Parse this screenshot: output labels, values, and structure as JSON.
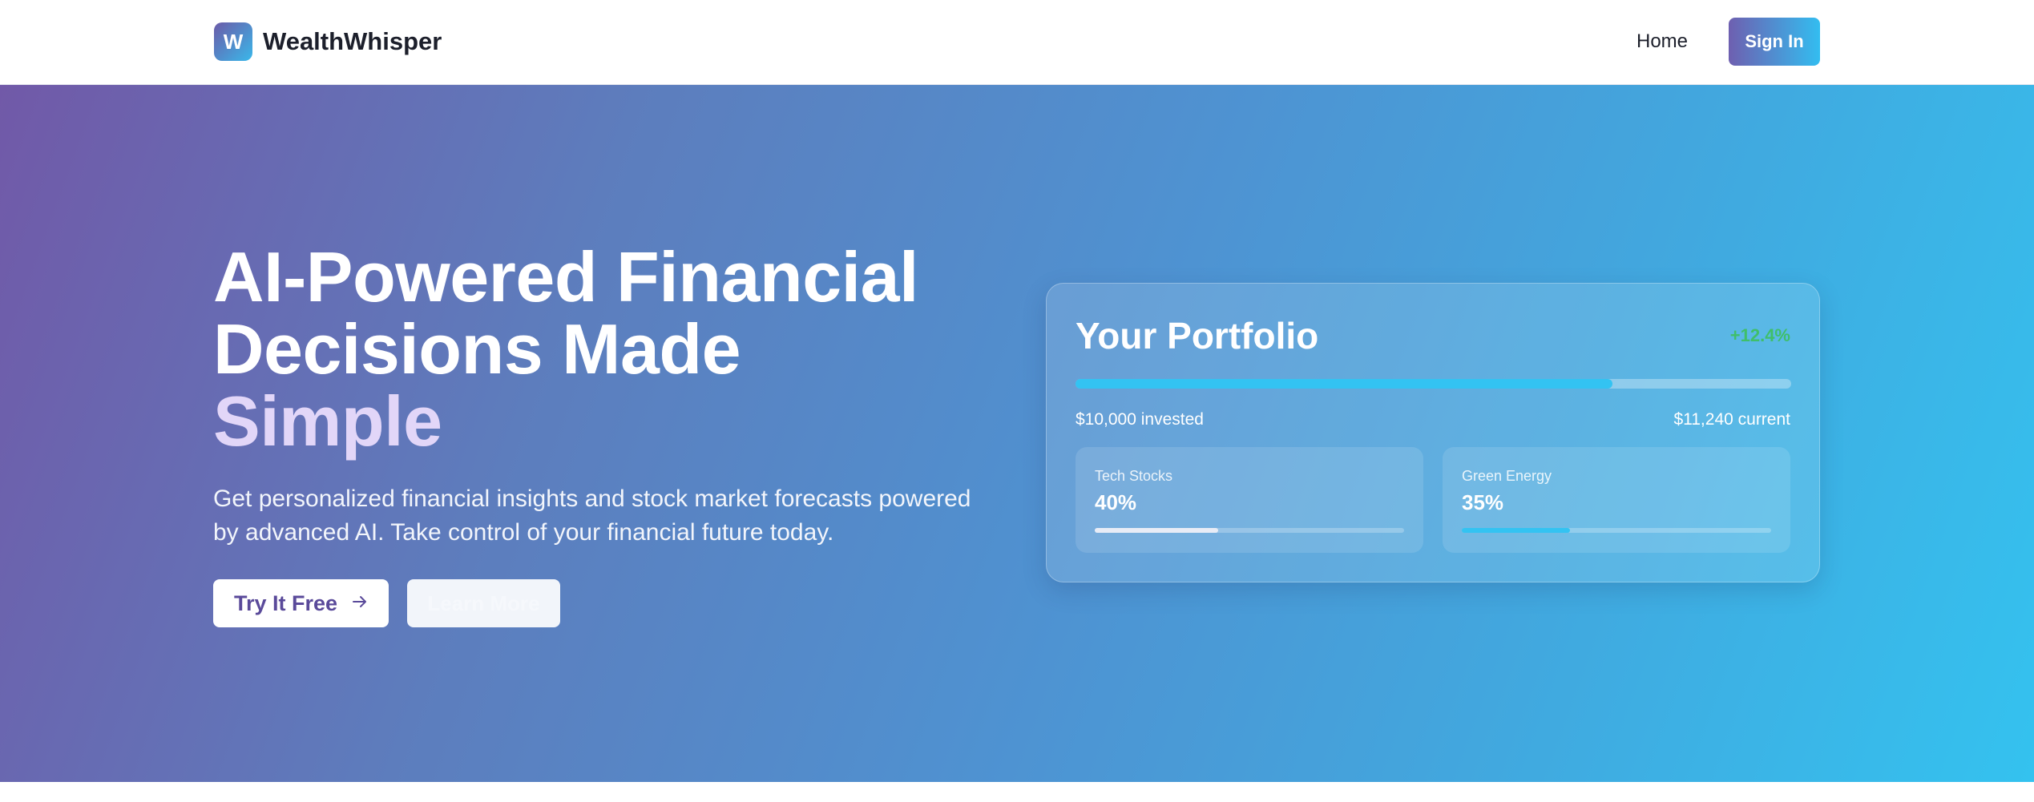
{
  "header": {
    "logo_letter": "W",
    "brand": "WealthWhisper",
    "nav_home": "Home",
    "sign_in": "Sign In"
  },
  "hero": {
    "title_line1": "AI-Powered Financial",
    "title_line2": "Decisions Made",
    "title_accent": "Simple",
    "subtitle": "Get personalized financial insights and stock market forecasts powered by advanced AI. Take control of your financial future today.",
    "primary_button": "Try It Free",
    "primary_icon": "arrow-right-icon",
    "secondary_button": "Learn More"
  },
  "portfolio": {
    "title": "Your Portfolio",
    "change": "+12.4%",
    "progress_fraction": 0.75,
    "invested": "$10,000 invested",
    "current": "$11,240 current",
    "allocations": [
      {
        "label": "Tech Stocks",
        "value": "40%",
        "fraction": 0.4,
        "color": "#e8ecf6"
      },
      {
        "label": "Green Energy",
        "value": "35%",
        "fraction": 0.35,
        "color": "#33c3f2"
      }
    ]
  },
  "colors": {
    "accent_gradient_start": "#7159a8",
    "accent_gradient_end": "#34c2ef",
    "positive": "#3fbf6a"
  }
}
